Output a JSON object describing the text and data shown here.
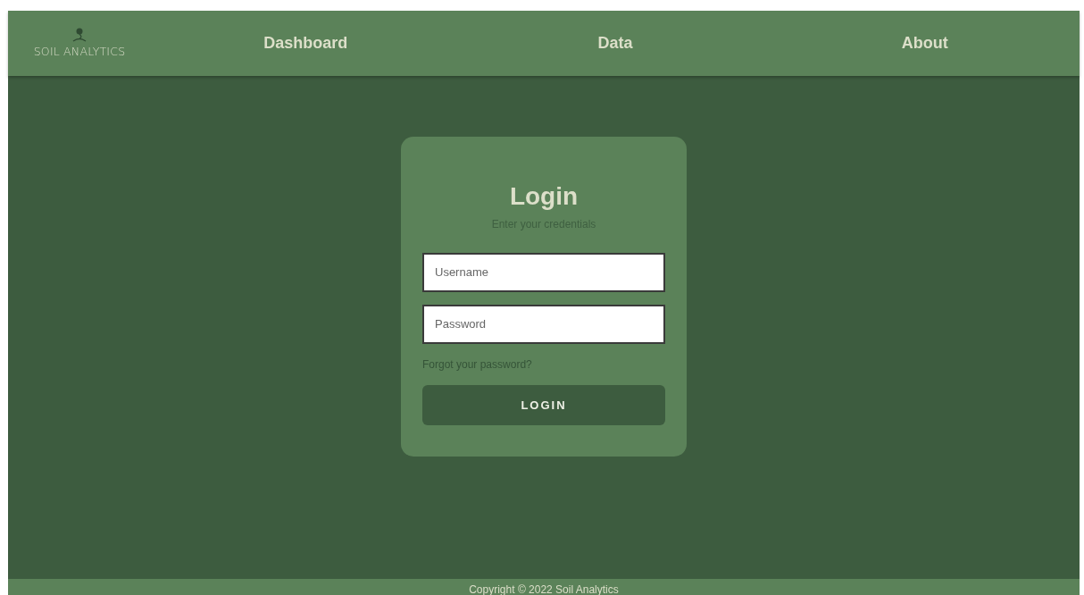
{
  "brand": {
    "name": "SOIL ANALYTICS"
  },
  "nav": [
    {
      "label": "Dashboard"
    },
    {
      "label": "Data"
    },
    {
      "label": "About"
    }
  ],
  "login": {
    "title": "Login",
    "subtitle": "Enter your credentials",
    "fields": [
      {
        "placeholder": "Username"
      },
      {
        "placeholder": "Password"
      }
    ],
    "forgot_link": "Forgot your password?",
    "submit": "LOGIN"
  },
  "footer": {
    "text": "Copyright © 2022 Soil Analytics"
  }
}
